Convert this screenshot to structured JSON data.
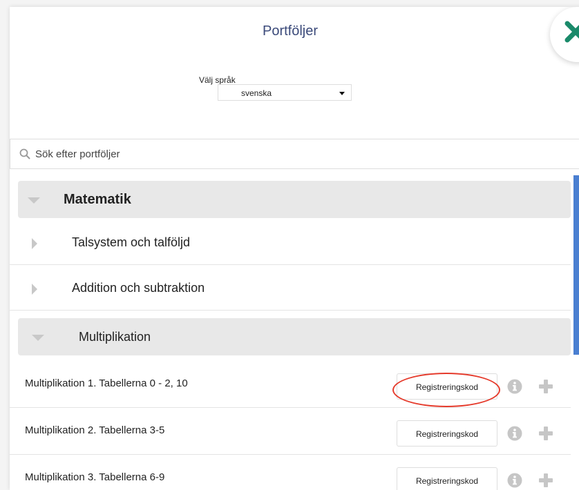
{
  "header": {
    "title": "Portföljer"
  },
  "language": {
    "label": "Välj språk",
    "selected": "svenska"
  },
  "search": {
    "placeholder": "Sök efter portföljer"
  },
  "tree": {
    "category": "Matematik",
    "subcategories": [
      {
        "label": "Talsystem och talföljd",
        "expanded": false
      },
      {
        "label": "Addition och subtraktion",
        "expanded": false
      },
      {
        "label": "Multiplikation",
        "expanded": true
      }
    ],
    "items": [
      {
        "label": "Multiplikation 1. Tabellerna 0 - 2, 10",
        "button": "Registreringskod",
        "highlighted": true
      },
      {
        "label": "Multiplikation 2. Tabellerna 3-5",
        "button": "Registreringskod",
        "highlighted": false
      },
      {
        "label": "Multiplikation 3. Tabellerna 6-9",
        "button": "Registreringskod",
        "highlighted": false
      }
    ]
  },
  "colors": {
    "accent": "#4a7fd1",
    "highlight": "#e53a2b",
    "close": "#1a8a6a",
    "title": "#3b4a7a"
  },
  "icons": [
    "close-icon",
    "chevron-down-icon",
    "search-icon",
    "triangle-down-icon",
    "triangle-right-icon",
    "info-icon",
    "plus-icon"
  ]
}
